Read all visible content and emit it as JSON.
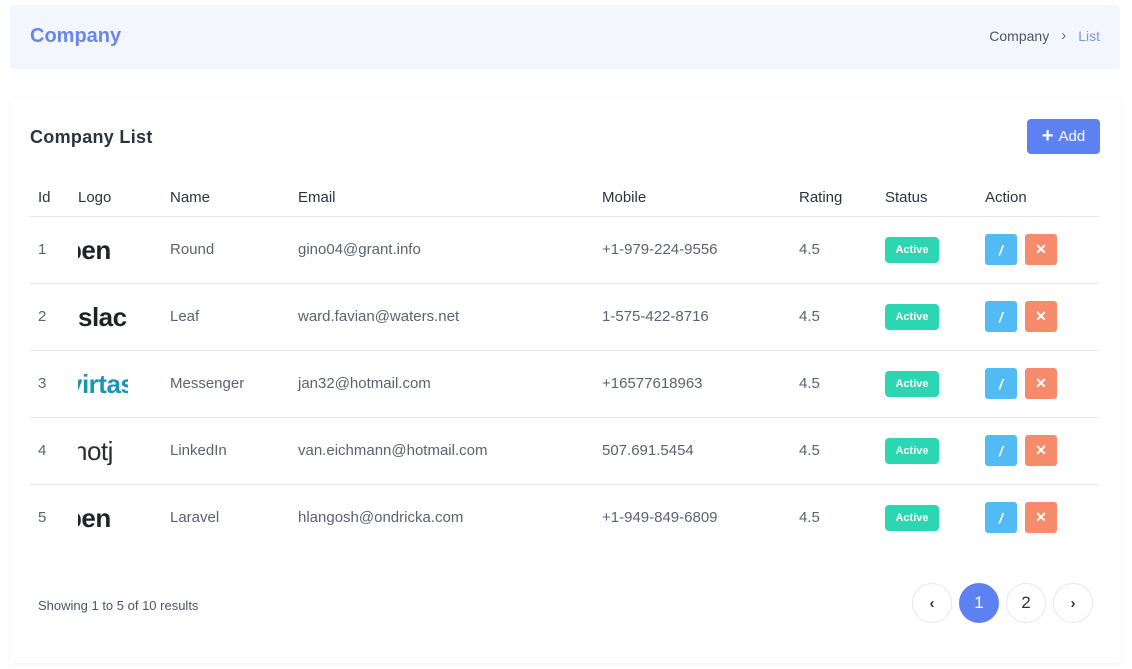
{
  "header": {
    "title": "Company",
    "breadcrumb": {
      "parent": "Company",
      "separator": "›",
      "current": "List"
    }
  },
  "card": {
    "title": "Company List",
    "add_button": {
      "icon": "plus-icon",
      "glyph": "+",
      "label": "Add"
    }
  },
  "table": {
    "columns": [
      "Id",
      "Logo",
      "Name",
      "Email",
      "Mobile",
      "Rating",
      "Status",
      "Action"
    ],
    "rows": [
      {
        "id": "1",
        "logo_text": "pen",
        "logo_style": "dark",
        "name": "Round",
        "email": "gino04@grant.info",
        "mobile": "+1-979-224-9556",
        "rating": "4.5",
        "status": "Active"
      },
      {
        "id": "2",
        "logo_text": "slac",
        "logo_style": "dark",
        "name": "Leaf",
        "email": "ward.favian@waters.net",
        "mobile": "1-575-422-8716",
        "rating": "4.5",
        "status": "Active"
      },
      {
        "id": "3",
        "logo_text": "virtas",
        "logo_style": "teal",
        "name": "Messenger",
        "email": "jan32@hotmail.com",
        "mobile": "+16577618963",
        "rating": "4.5",
        "status": "Active"
      },
      {
        "id": "4",
        "logo_text": "hotj",
        "logo_style": "mid",
        "name": "LinkedIn",
        "email": "van.eichmann@hotmail.com",
        "mobile": "507.691.5454",
        "rating": "4.5",
        "status": "Active"
      },
      {
        "id": "5",
        "logo_text": "pen",
        "logo_style": "dark",
        "name": "Laravel",
        "email": "hlangosh@ondricka.com",
        "mobile": "+1-949-849-6809",
        "rating": "4.5",
        "status": "Active"
      }
    ],
    "action_icons": {
      "edit": "pencil-icon",
      "delete": "close-icon"
    },
    "action_glyphs": {
      "edit": "/",
      "delete": "✕"
    }
  },
  "footer": {
    "summary": "Showing 1 to 5 of 10 results",
    "pagination": {
      "prev": "‹",
      "pages": [
        "1",
        "2"
      ],
      "active_page": "1",
      "next": "›"
    }
  },
  "colors": {
    "primary": "#5d81f0",
    "header_title": "#6b85ec",
    "status_active": "#2dd6b2",
    "edit_button": "#53bbf3",
    "delete_button": "#f68b6c"
  }
}
